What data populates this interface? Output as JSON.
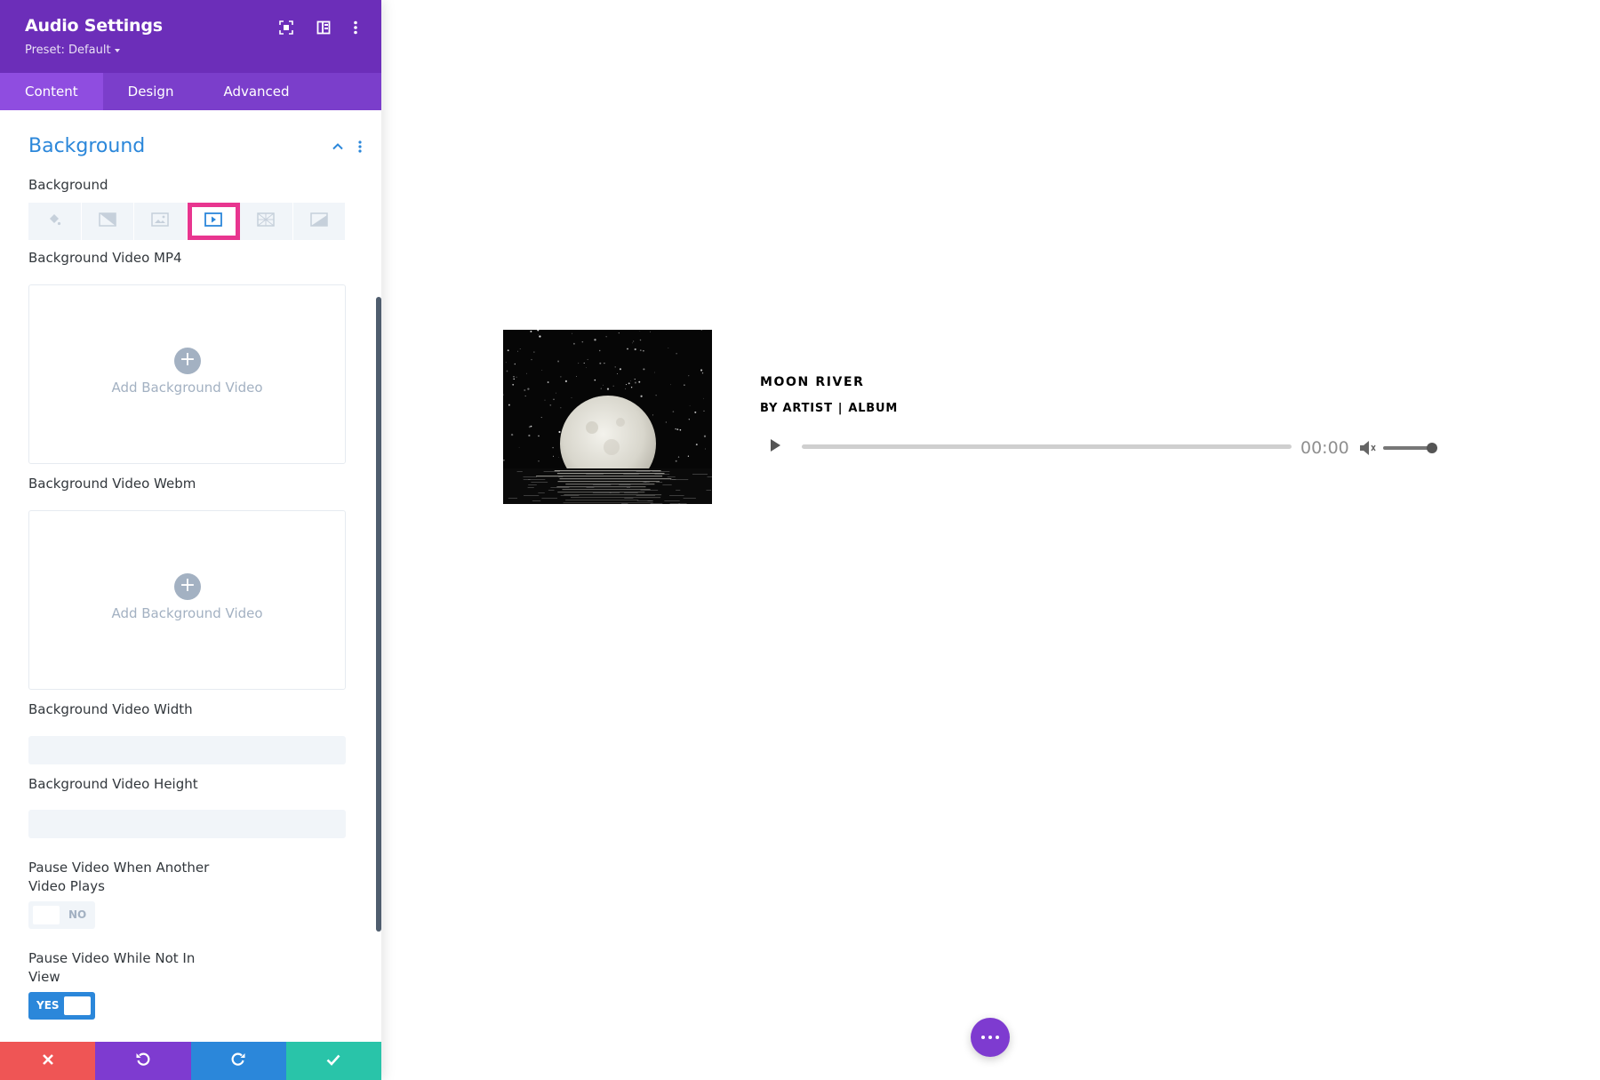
{
  "panel": {
    "title": "Audio Settings",
    "preset_label": "Preset: Default",
    "header_icons": [
      "expand-icon",
      "split-view-icon",
      "more-vertical-icon"
    ],
    "tabs": [
      {
        "label": "Content",
        "active": true
      },
      {
        "label": "Design",
        "active": false
      },
      {
        "label": "Advanced",
        "active": false
      }
    ],
    "section": {
      "title": "Background",
      "collapsed": false
    },
    "background": {
      "label": "Background",
      "types": [
        {
          "icon": "color-bucket-icon",
          "active": false
        },
        {
          "icon": "gradient-icon",
          "active": false
        },
        {
          "icon": "image-icon",
          "active": false
        },
        {
          "icon": "video-icon",
          "active": true
        },
        {
          "icon": "pattern-icon",
          "active": false
        },
        {
          "icon": "mask-icon",
          "active": false
        }
      ]
    },
    "video_mp4": {
      "label": "Background Video MP4",
      "button": "Add Background Video"
    },
    "video_webm": {
      "label": "Background Video Webm",
      "button": "Add Background Video"
    },
    "video_width": {
      "label": "Background Video Width",
      "value": ""
    },
    "video_height": {
      "label": "Background Video Height",
      "value": ""
    },
    "pause_other": {
      "label_line1": "Pause Video When Another",
      "label_line2": "Video Plays",
      "state": "NO"
    },
    "pause_view": {
      "label_line1": "Pause Video While Not In",
      "label_line2": "View",
      "state": "YES"
    },
    "footer": {
      "colors": {
        "cancel": "#ef5555",
        "undo": "#7e3bd0",
        "redo": "#2b87da",
        "save": "#29c4a9"
      },
      "icons": [
        "close-icon",
        "undo-icon",
        "redo-icon",
        "check-icon"
      ]
    }
  },
  "player": {
    "title": "MOON RIVER",
    "artist": "BY ARTIST",
    "separator": "|",
    "album": "ALBUM",
    "time": "00:00",
    "progress": 0,
    "volume": 0.9
  },
  "colors": {
    "header_purple": "#6c2eb9",
    "tabs_purple": "#7b3ecb",
    "active_tab": "#8f4de0",
    "accent_blue": "#2b87da",
    "highlight_pink": "#e8358f"
  }
}
